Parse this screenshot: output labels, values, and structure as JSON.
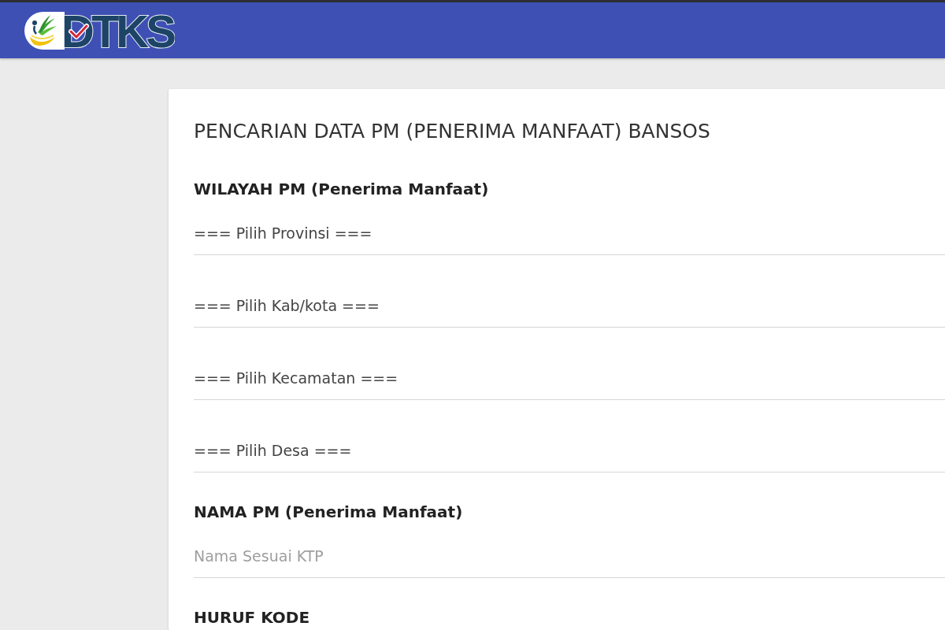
{
  "header": {
    "logo_text": "DTKS"
  },
  "form": {
    "title": "PENCARIAN DATA PM (PENERIMA MANFAAT) BANSOS",
    "sections": [
      {
        "heading": "WILAYAH PM (Penerima Manfaat)",
        "fields": [
          {
            "kind": "select",
            "value": "=== Pilih Provinsi ==="
          },
          {
            "kind": "select",
            "value": "=== Pilih Kab/kota ==="
          },
          {
            "kind": "select",
            "value": "=== Pilih Kecamatan ==="
          },
          {
            "kind": "select",
            "value": "=== Pilih Desa ==="
          }
        ]
      },
      {
        "heading": "NAMA PM (Penerima Manfaat)",
        "fields": [
          {
            "kind": "text",
            "placeholder": "Nama Sesuai KTP"
          }
        ]
      },
      {
        "heading": "HURUF KODE"
      }
    ]
  }
}
